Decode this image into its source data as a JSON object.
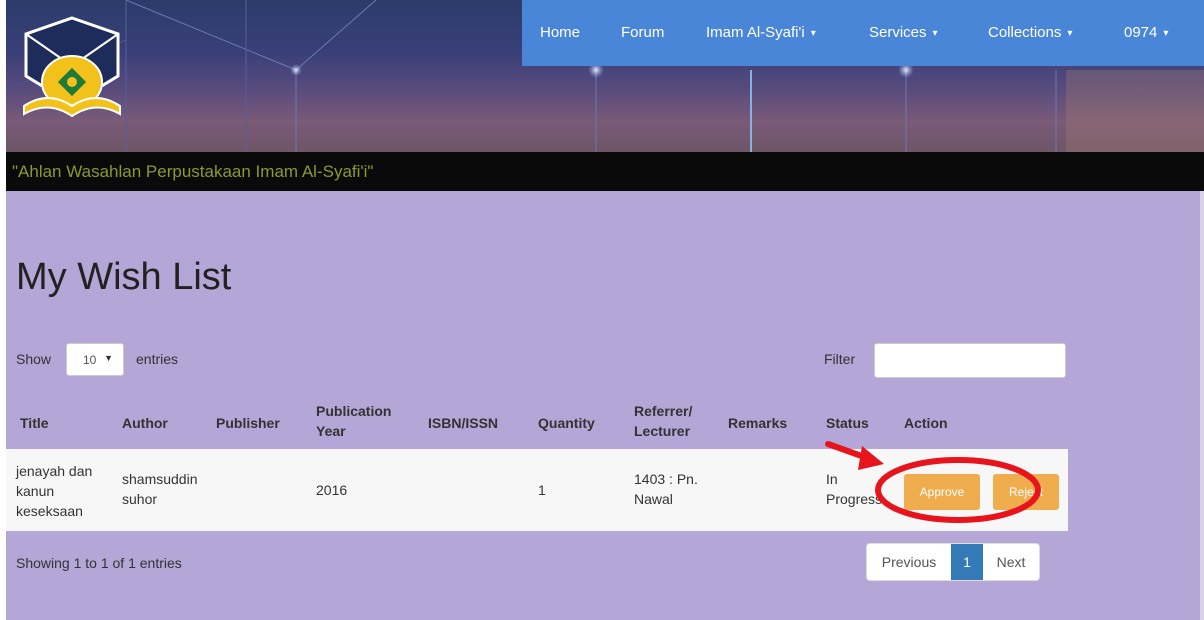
{
  "navbar": {
    "items": [
      {
        "label": "Home",
        "caret": ""
      },
      {
        "label": "Forum",
        "caret": ""
      },
      {
        "label": "Imam Al-Syafi'i",
        "caret": "▾"
      },
      {
        "label": "Services",
        "caret": "▾"
      },
      {
        "label": "Collections",
        "caret": "▾"
      },
      {
        "label": "0974",
        "caret": "▾"
      }
    ]
  },
  "banner": {
    "motto": "\"Ahlan Wasahlan Perpustakaan Imam Al-Syafi'i\""
  },
  "page": {
    "title": "My Wish List"
  },
  "table_controls": {
    "show_label": "Show",
    "entries_value": "10",
    "entries_label": "entries",
    "filter_label": "Filter"
  },
  "table": {
    "headers": {
      "title": "Title",
      "author": "Author",
      "publisher": "Publisher",
      "pub_year_1": "Publication",
      "pub_year_2": "Year",
      "isbn": "ISBN/ISSN",
      "quantity": "Quantity",
      "referrer_1": "Referrer/",
      "referrer_2": "Lecturer",
      "remarks": "Remarks",
      "status": "Status",
      "action": "Action"
    },
    "rows": [
      {
        "title_1": "jenayah dan",
        "title_2": "kanun",
        "title_3": "keseksaan",
        "author_1": "shamsuddin",
        "author_2": "suhor",
        "publisher": "",
        "year": "2016",
        "isbn": "",
        "quantity": "1",
        "referrer_1": "1403 : Pn.",
        "referrer_2": "Nawal",
        "remarks": "",
        "status_1": "In",
        "status_2": "Progress",
        "approve_label": "Approve",
        "reject_label": "Reject"
      }
    ]
  },
  "footer": {
    "showing": "Showing 1 to 1 of 1 entries",
    "previous": "Previous",
    "current_page": "1",
    "next": "Next"
  },
  "colors": {
    "navbar": "#4a86d8",
    "content_bg": "#b4a6d6",
    "button": "#f0ad4e",
    "active_page": "#337ab7",
    "annotation": "#e8141c"
  }
}
